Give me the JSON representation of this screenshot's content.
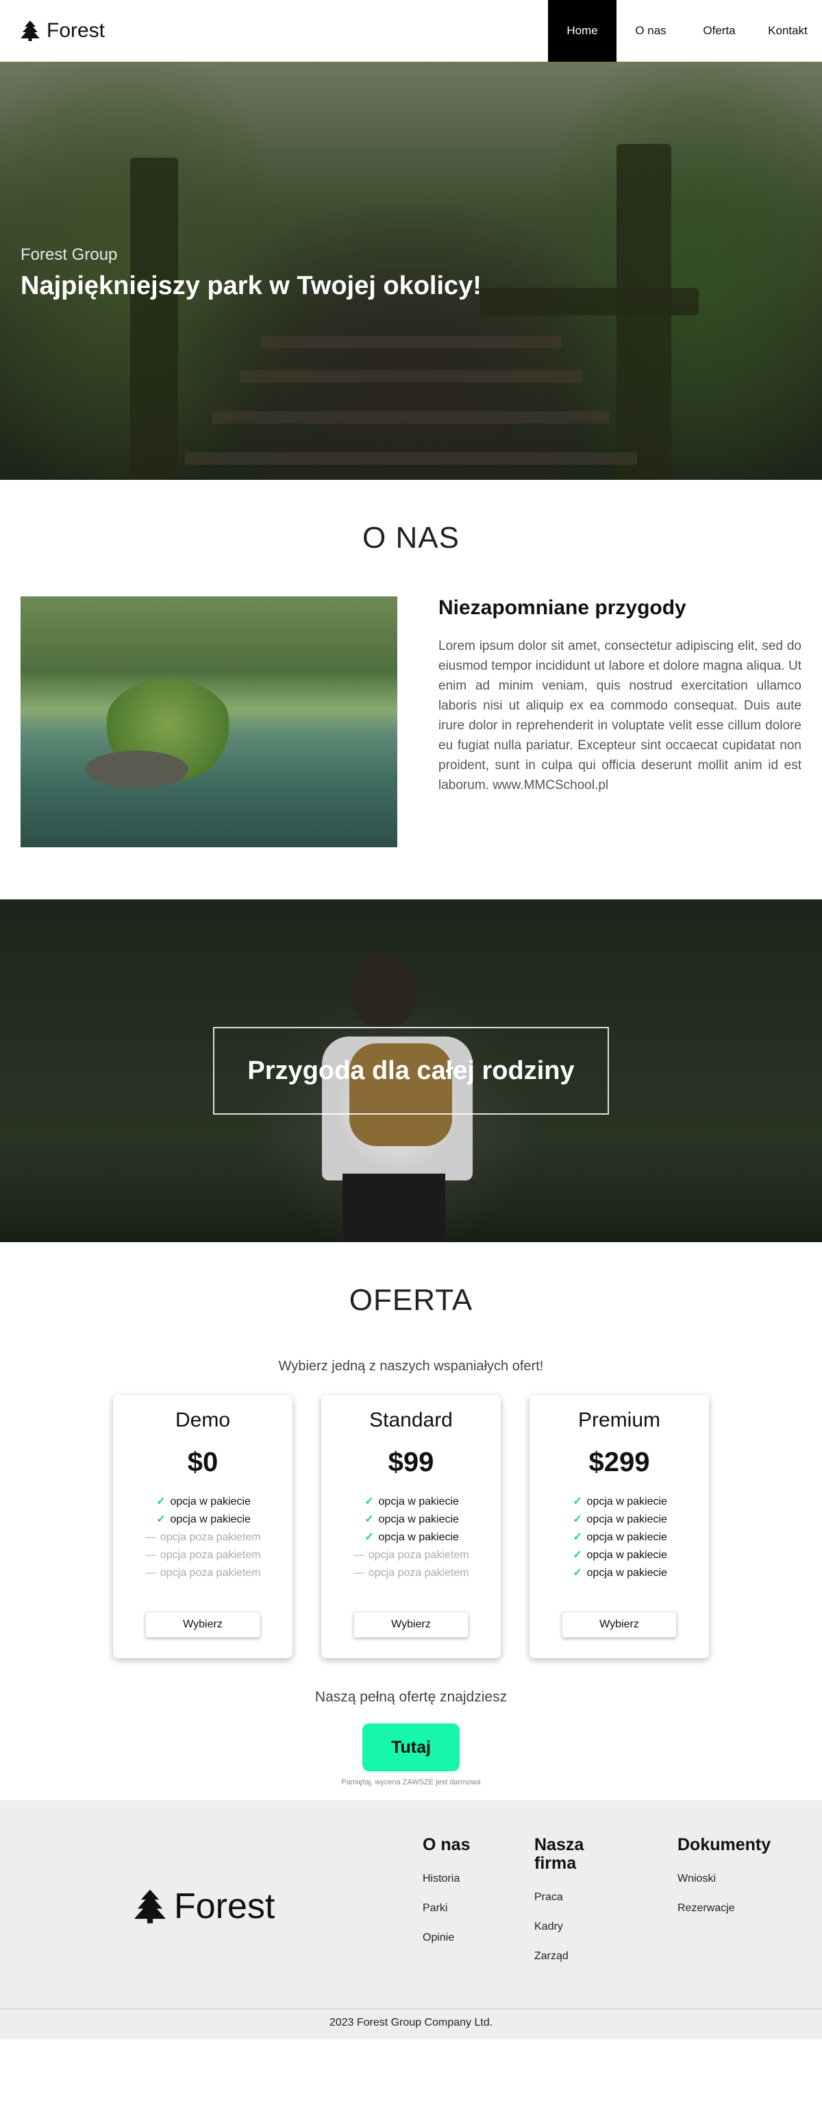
{
  "nav": {
    "brand": "Forest",
    "items": [
      {
        "label": "Home",
        "active": true
      },
      {
        "label": "O nas",
        "active": false
      },
      {
        "label": "Oferta",
        "active": false
      },
      {
        "label": "Kontakt",
        "active": false
      }
    ]
  },
  "hero": {
    "subtitle": "Forest Group",
    "title": "Najpiękniejszy park w Twojej okolicy!"
  },
  "about": {
    "section_title": "O NAS",
    "heading": "Niezapomniane przygody",
    "body": "Lorem ipsum dolor sit amet, consectetur adipiscing elit, sed do eiusmod tempor incididunt ut labore et dolore magna aliqua. Ut enim ad minim veniam, quis nostrud exercitation ullamco laboris nisi ut aliquip ex ea commodo consequat. Duis aute irure dolor in reprehenderit in voluptate velit esse cillum dolore eu fugiat nulla pariatur. Excepteur sint occaecat cupidatat non proident, sunt in culpa qui officia deserunt mollit anim id est laborum. www.MMCSchool.pl"
  },
  "banner": {
    "text": "Przygoda dla całej rodziny"
  },
  "offer": {
    "section_title": "OFERTA",
    "lead": "Wybierz jedną z naszych wspaniałych ofert!",
    "cards": [
      {
        "name": "Demo",
        "price": "$0",
        "button": "Wybierz",
        "features": [
          {
            "text": "opcja w pakiecie",
            "included": true
          },
          {
            "text": "opcja w pakiecie",
            "included": true
          },
          {
            "text": "opcja poza pakietem",
            "included": false
          },
          {
            "text": "opcja poza pakietem",
            "included": false
          },
          {
            "text": "opcja poza pakietem",
            "included": false
          }
        ]
      },
      {
        "name": "Standard",
        "price": "$99",
        "button": "Wybierz",
        "features": [
          {
            "text": "opcja w pakiecie",
            "included": true
          },
          {
            "text": "opcja w pakiecie",
            "included": true
          },
          {
            "text": "opcja w pakiecie",
            "included": true
          },
          {
            "text": "opcja poza pakietem",
            "included": false
          },
          {
            "text": "opcja poza pakietem",
            "included": false
          }
        ]
      },
      {
        "name": "Premium",
        "price": "$299",
        "button": "Wybierz",
        "features": [
          {
            "text": "opcja w pakiecie",
            "included": true
          },
          {
            "text": "opcja w pakiecie",
            "included": true
          },
          {
            "text": "opcja w pakiecie",
            "included": true
          },
          {
            "text": "opcja w pakiecie",
            "included": true
          },
          {
            "text": "opcja w pakiecie",
            "included": true
          }
        ]
      }
    ],
    "more_text": "Naszą pełną ofertę znajdziesz",
    "cta": "Tutaj",
    "note": "Pamiętaj, wycena ZAWSZE jest darmowa"
  },
  "footer": {
    "brand": "Forest",
    "columns": [
      {
        "title": "O nas",
        "links": [
          "Historia",
          "Parki",
          "Opinie"
        ]
      },
      {
        "title": "Nasza firma",
        "links": [
          "Praca",
          "Kadry",
          "Zarząd"
        ]
      },
      {
        "title": "Dokumenty",
        "links": [
          "Wnioski",
          "Rezerwacje"
        ]
      }
    ],
    "copyright": "2023 Forest Group Company Ltd."
  },
  "colors": {
    "accent": "#16f7ab",
    "check": "#1ecd8f",
    "nav_active_bg": "#000000",
    "footer_bg": "#eeeeee"
  },
  "icons": {
    "brand": "tree-icon",
    "included": "check-icon",
    "excluded": "dash-icon"
  }
}
